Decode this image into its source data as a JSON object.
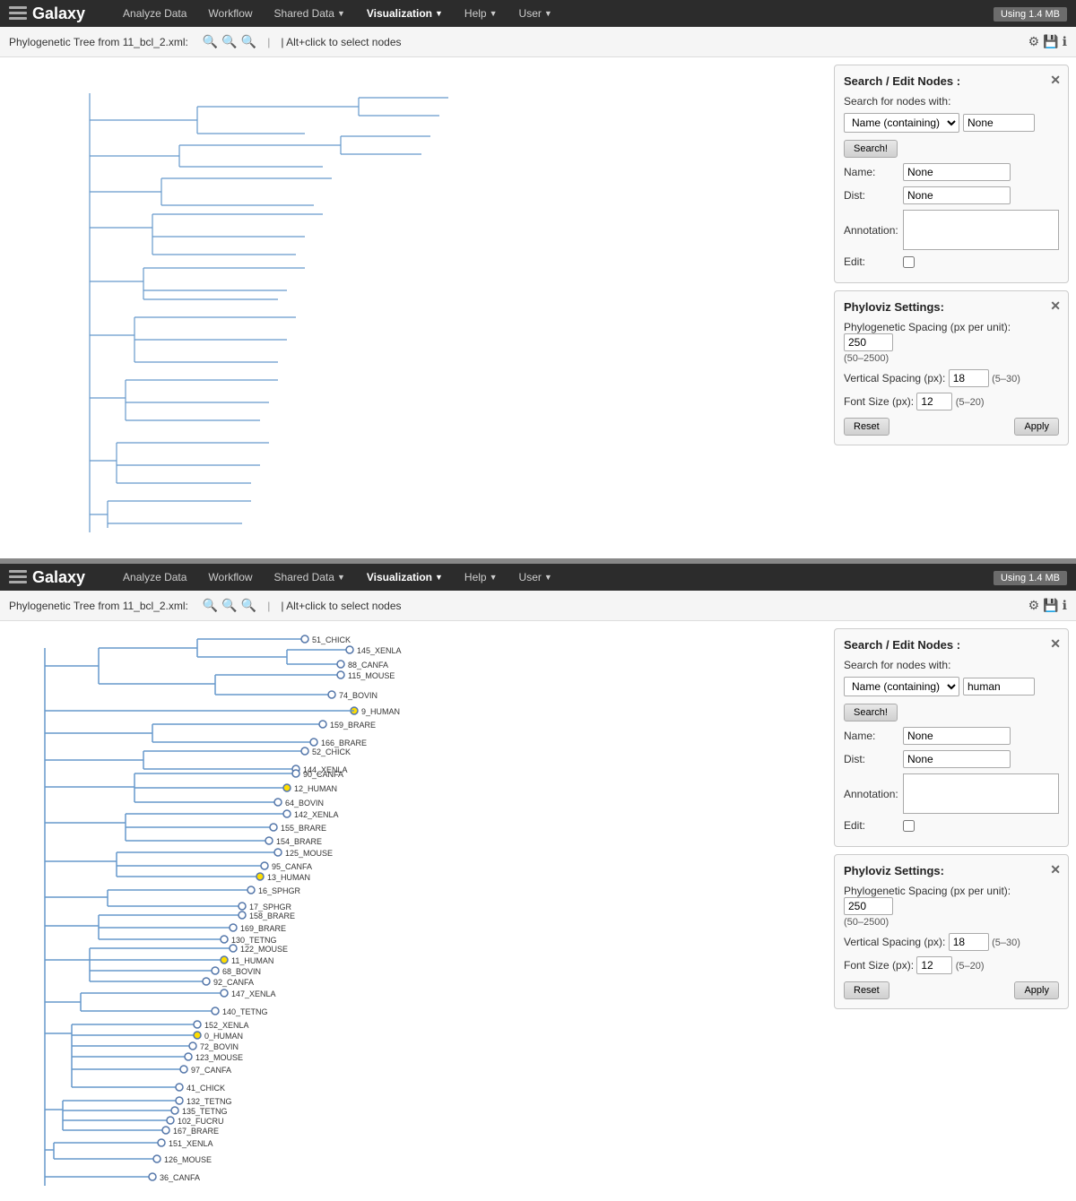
{
  "app": {
    "logo": "Galaxy",
    "using_badge": "Using 1.4 MB"
  },
  "navbar": {
    "items": [
      {
        "label": "Analyze Data",
        "name": "analyze-data",
        "has_arrow": false
      },
      {
        "label": "Workflow",
        "name": "workflow",
        "has_arrow": false
      },
      {
        "label": "Shared Data",
        "name": "shared-data",
        "has_arrow": true
      },
      {
        "label": "Visualization",
        "name": "visualization",
        "has_arrow": true,
        "active": true
      },
      {
        "label": "Help",
        "name": "help",
        "has_arrow": true
      },
      {
        "label": "User",
        "name": "user",
        "has_arrow": true
      }
    ]
  },
  "toolbar": {
    "title": "Phylogenetic Tree from 11_bcl_2.xml:",
    "hint": "| Alt+click to select nodes"
  },
  "section1": {
    "search_panel": {
      "title": "Search / Edit Nodes :",
      "search_label": "Search for nodes with:",
      "search_select_value": "Name (containing)",
      "search_value": "None",
      "search_btn": "Search!",
      "name_label": "Name:",
      "name_value": "None",
      "dist_label": "Dist:",
      "dist_value": "None",
      "annotation_label": "Annotation:",
      "edit_label": "Edit:"
    },
    "settings_panel": {
      "title": "Phyloviz Settings:",
      "phylo_label": "Phylogenetic Spacing (px per unit):",
      "phylo_value": "250",
      "phylo_range": "(50–2500)",
      "vert_label": "Vertical Spacing (px):",
      "vert_value": "18",
      "vert_range": "(5–30)",
      "font_label": "Font Size (px):",
      "font_value": "12",
      "font_range": "(5–20)",
      "reset_btn": "Reset",
      "apply_btn": "Apply"
    }
  },
  "section2": {
    "search_panel": {
      "title": "Search / Edit Nodes :",
      "search_label": "Search for nodes with:",
      "search_select_value": "Name (containing)",
      "search_value": "human",
      "search_btn": "Search!",
      "name_label": "Name:",
      "name_value": "None",
      "dist_label": "Dist:",
      "dist_value": "None",
      "annotation_label": "Annotation:",
      "edit_label": "Edit:"
    },
    "settings_panel": {
      "title": "Phyloviz Settings:",
      "phylo_label": "Phylogenetic Spacing (px per unit):",
      "phylo_value": "250",
      "phylo_range": "(50–2500)",
      "vert_label": "Vertical Spacing (px):",
      "vert_value": "18",
      "vert_range": "(5–30)",
      "font_label": "Font Size (px):",
      "font_value": "12",
      "font_range": "(5–20)",
      "reset_btn": "Reset",
      "apply_btn": "Apply"
    }
  }
}
